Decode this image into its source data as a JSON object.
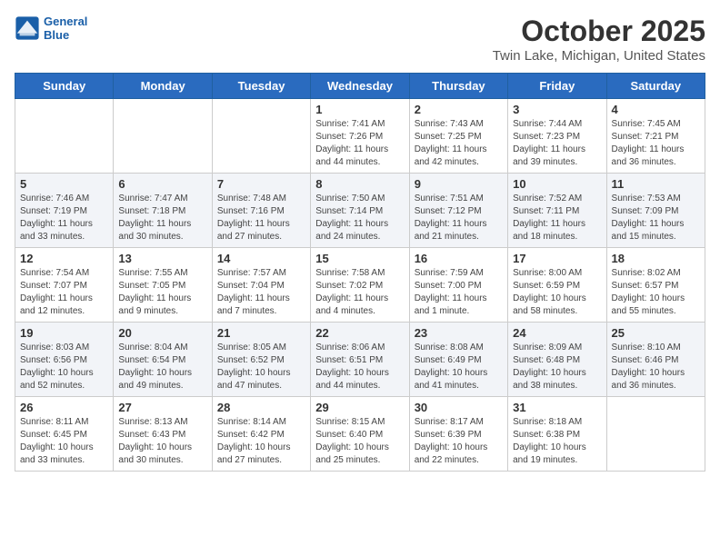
{
  "logo": {
    "line1": "General",
    "line2": "Blue"
  },
  "title": "October 2025",
  "location": "Twin Lake, Michigan, United States",
  "days_of_week": [
    "Sunday",
    "Monday",
    "Tuesday",
    "Wednesday",
    "Thursday",
    "Friday",
    "Saturday"
  ],
  "weeks": [
    [
      {
        "day": "",
        "sunrise": "",
        "sunset": "",
        "daylight": ""
      },
      {
        "day": "",
        "sunrise": "",
        "sunset": "",
        "daylight": ""
      },
      {
        "day": "",
        "sunrise": "",
        "sunset": "",
        "daylight": ""
      },
      {
        "day": "1",
        "sunrise": "Sunrise: 7:41 AM",
        "sunset": "Sunset: 7:26 PM",
        "daylight": "Daylight: 11 hours and 44 minutes."
      },
      {
        "day": "2",
        "sunrise": "Sunrise: 7:43 AM",
        "sunset": "Sunset: 7:25 PM",
        "daylight": "Daylight: 11 hours and 42 minutes."
      },
      {
        "day": "3",
        "sunrise": "Sunrise: 7:44 AM",
        "sunset": "Sunset: 7:23 PM",
        "daylight": "Daylight: 11 hours and 39 minutes."
      },
      {
        "day": "4",
        "sunrise": "Sunrise: 7:45 AM",
        "sunset": "Sunset: 7:21 PM",
        "daylight": "Daylight: 11 hours and 36 minutes."
      }
    ],
    [
      {
        "day": "5",
        "sunrise": "Sunrise: 7:46 AM",
        "sunset": "Sunset: 7:19 PM",
        "daylight": "Daylight: 11 hours and 33 minutes."
      },
      {
        "day": "6",
        "sunrise": "Sunrise: 7:47 AM",
        "sunset": "Sunset: 7:18 PM",
        "daylight": "Daylight: 11 hours and 30 minutes."
      },
      {
        "day": "7",
        "sunrise": "Sunrise: 7:48 AM",
        "sunset": "Sunset: 7:16 PM",
        "daylight": "Daylight: 11 hours and 27 minutes."
      },
      {
        "day": "8",
        "sunrise": "Sunrise: 7:50 AM",
        "sunset": "Sunset: 7:14 PM",
        "daylight": "Daylight: 11 hours and 24 minutes."
      },
      {
        "day": "9",
        "sunrise": "Sunrise: 7:51 AM",
        "sunset": "Sunset: 7:12 PM",
        "daylight": "Daylight: 11 hours and 21 minutes."
      },
      {
        "day": "10",
        "sunrise": "Sunrise: 7:52 AM",
        "sunset": "Sunset: 7:11 PM",
        "daylight": "Daylight: 11 hours and 18 minutes."
      },
      {
        "day": "11",
        "sunrise": "Sunrise: 7:53 AM",
        "sunset": "Sunset: 7:09 PM",
        "daylight": "Daylight: 11 hours and 15 minutes."
      }
    ],
    [
      {
        "day": "12",
        "sunrise": "Sunrise: 7:54 AM",
        "sunset": "Sunset: 7:07 PM",
        "daylight": "Daylight: 11 hours and 12 minutes."
      },
      {
        "day": "13",
        "sunrise": "Sunrise: 7:55 AM",
        "sunset": "Sunset: 7:05 PM",
        "daylight": "Daylight: 11 hours and 9 minutes."
      },
      {
        "day": "14",
        "sunrise": "Sunrise: 7:57 AM",
        "sunset": "Sunset: 7:04 PM",
        "daylight": "Daylight: 11 hours and 7 minutes."
      },
      {
        "day": "15",
        "sunrise": "Sunrise: 7:58 AM",
        "sunset": "Sunset: 7:02 PM",
        "daylight": "Daylight: 11 hours and 4 minutes."
      },
      {
        "day": "16",
        "sunrise": "Sunrise: 7:59 AM",
        "sunset": "Sunset: 7:00 PM",
        "daylight": "Daylight: 11 hours and 1 minute."
      },
      {
        "day": "17",
        "sunrise": "Sunrise: 8:00 AM",
        "sunset": "Sunset: 6:59 PM",
        "daylight": "Daylight: 10 hours and 58 minutes."
      },
      {
        "day": "18",
        "sunrise": "Sunrise: 8:02 AM",
        "sunset": "Sunset: 6:57 PM",
        "daylight": "Daylight: 10 hours and 55 minutes."
      }
    ],
    [
      {
        "day": "19",
        "sunrise": "Sunrise: 8:03 AM",
        "sunset": "Sunset: 6:56 PM",
        "daylight": "Daylight: 10 hours and 52 minutes."
      },
      {
        "day": "20",
        "sunrise": "Sunrise: 8:04 AM",
        "sunset": "Sunset: 6:54 PM",
        "daylight": "Daylight: 10 hours and 49 minutes."
      },
      {
        "day": "21",
        "sunrise": "Sunrise: 8:05 AM",
        "sunset": "Sunset: 6:52 PM",
        "daylight": "Daylight: 10 hours and 47 minutes."
      },
      {
        "day": "22",
        "sunrise": "Sunrise: 8:06 AM",
        "sunset": "Sunset: 6:51 PM",
        "daylight": "Daylight: 10 hours and 44 minutes."
      },
      {
        "day": "23",
        "sunrise": "Sunrise: 8:08 AM",
        "sunset": "Sunset: 6:49 PM",
        "daylight": "Daylight: 10 hours and 41 minutes."
      },
      {
        "day": "24",
        "sunrise": "Sunrise: 8:09 AM",
        "sunset": "Sunset: 6:48 PM",
        "daylight": "Daylight: 10 hours and 38 minutes."
      },
      {
        "day": "25",
        "sunrise": "Sunrise: 8:10 AM",
        "sunset": "Sunset: 6:46 PM",
        "daylight": "Daylight: 10 hours and 36 minutes."
      }
    ],
    [
      {
        "day": "26",
        "sunrise": "Sunrise: 8:11 AM",
        "sunset": "Sunset: 6:45 PM",
        "daylight": "Daylight: 10 hours and 33 minutes."
      },
      {
        "day": "27",
        "sunrise": "Sunrise: 8:13 AM",
        "sunset": "Sunset: 6:43 PM",
        "daylight": "Daylight: 10 hours and 30 minutes."
      },
      {
        "day": "28",
        "sunrise": "Sunrise: 8:14 AM",
        "sunset": "Sunset: 6:42 PM",
        "daylight": "Daylight: 10 hours and 27 minutes."
      },
      {
        "day": "29",
        "sunrise": "Sunrise: 8:15 AM",
        "sunset": "Sunset: 6:40 PM",
        "daylight": "Daylight: 10 hours and 25 minutes."
      },
      {
        "day": "30",
        "sunrise": "Sunrise: 8:17 AM",
        "sunset": "Sunset: 6:39 PM",
        "daylight": "Daylight: 10 hours and 22 minutes."
      },
      {
        "day": "31",
        "sunrise": "Sunrise: 8:18 AM",
        "sunset": "Sunset: 6:38 PM",
        "daylight": "Daylight: 10 hours and 19 minutes."
      },
      {
        "day": "",
        "sunrise": "",
        "sunset": "",
        "daylight": ""
      }
    ]
  ]
}
